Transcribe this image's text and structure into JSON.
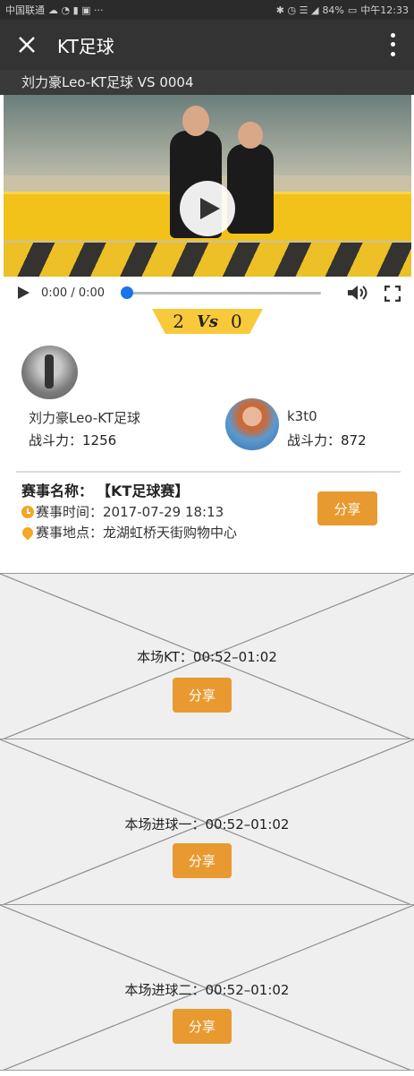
{
  "status_bar": {
    "carrier": "中国联通",
    "battery": "84%",
    "time": "中午12:33"
  },
  "app_bar": {
    "title": "KT足球"
  },
  "match": {
    "title": "刘力豪Leo-KT足球 VS 0004"
  },
  "video": {
    "time": "0:00 / 0:00",
    "progress": 0
  },
  "score": {
    "home": "2",
    "vs": "Vs",
    "away": "0"
  },
  "players": [
    {
      "name": "刘力豪Leo-KT足球",
      "power": "战斗力：1256"
    },
    {
      "name": "k3t0",
      "power": "战斗力：872"
    }
  ],
  "event": {
    "name_label": "赛事名称：",
    "name_value": "【KT足球赛】",
    "time_label": "赛事时间：",
    "time_value": "2017-07-29 18:13",
    "location_label": "赛事地点：",
    "location_value": "龙湖虹桥天街购物中心",
    "share_label": "分享"
  },
  "clips": [
    {
      "label": "本场KT：00:52–01:02",
      "share_label": "分享"
    },
    {
      "label": "本场进球一：00:52–01:02",
      "share_label": "分享"
    },
    {
      "label": "本场进球二：00:52–01:02",
      "share_label": "分享"
    }
  ],
  "colors": {
    "accent": "#e89a30",
    "score_banner": "#f8c93a",
    "seek_knob": "#1a73e8"
  }
}
